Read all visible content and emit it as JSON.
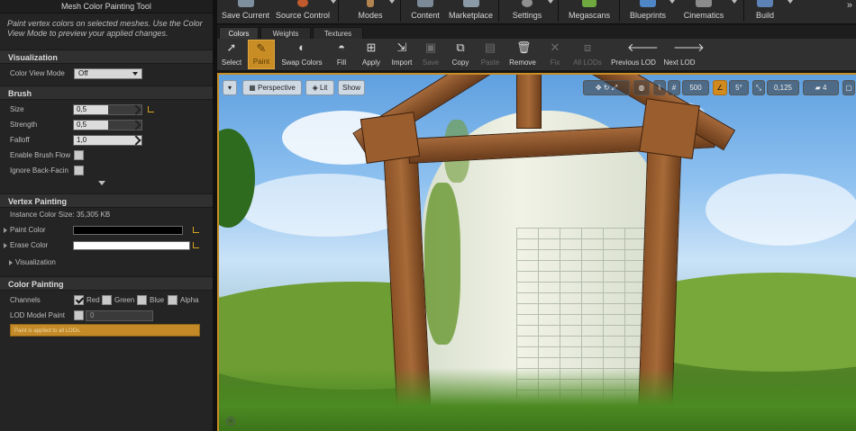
{
  "left_panel": {
    "title": "Mesh Color Painting Tool",
    "intro": "Paint vertex colors on selected meshes.  Use the Color View Mode to preview your applied changes.",
    "visualization": {
      "header": "Visualization",
      "color_view_mode_label": "Color View Mode",
      "color_view_mode_value": "Off"
    },
    "brush": {
      "header": "Brush",
      "size_label": "Size",
      "size_value": "0,5",
      "strength_label": "Strength",
      "strength_value": "0,5",
      "falloff_label": "Falloff",
      "falloff_value": "1,0",
      "flow_label": "Enable Brush Flow",
      "backface_label": "Ignore Back-Facin"
    },
    "vertex_painting": {
      "header": "Vertex Painting",
      "instance_size": "Instance Color Size: 35,305 KB",
      "paint_color_label": "Paint Color",
      "paint_color": "#000000",
      "erase_color_label": "Erase Color",
      "erase_color": "#ffffff",
      "visualization_label": "Visualization"
    },
    "color_painting": {
      "header": "Color Painting",
      "channels_label": "Channels",
      "red": "Red",
      "green": "Green",
      "blue": "Blue",
      "alpha": "Alpha",
      "lod_label": "LOD Model Paint",
      "lod_value": "0",
      "warning": "Paint is applied to all LODs."
    }
  },
  "toolbar": {
    "save_current": "Save Current",
    "source_control": "Source Control",
    "modes": "Modes",
    "content": "Content",
    "marketplace": "Marketplace",
    "settings": "Settings",
    "megascans": "Megascans",
    "blueprints": "Blueprints",
    "cinematics": "Cinematics",
    "build": "Build",
    "more": "»"
  },
  "mode_tabs": [
    "Colors",
    "Weights",
    "Textures"
  ],
  "paint_toolbar": {
    "select": "Select",
    "paint": "Paint",
    "swap_colors": "Swap Colors",
    "fill": "Fill",
    "apply": "Apply",
    "import": "Import",
    "save": "Save",
    "copy": "Copy",
    "paste": "Paste",
    "remove": "Remove",
    "fix": "Fix",
    "all_lods": "All LODs",
    "previous_lod": "Previous LOD",
    "next_lod": "Next LOD"
  },
  "viewport": {
    "perspective": "Perspective",
    "lit": "Lit",
    "show": "Show",
    "grid_snap": "500",
    "rotation_snap": "5°",
    "scale_snap": "0,125",
    "camera_speed": "4"
  },
  "colors": {
    "accent": "#c98d25",
    "panel_bg": "#242424",
    "section_bg": "#303030"
  }
}
